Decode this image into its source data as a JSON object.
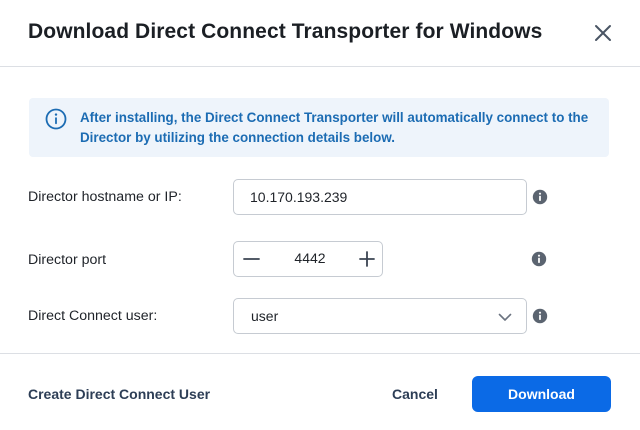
{
  "dialog": {
    "title": "Download Direct Connect Transporter for Windows",
    "close_icon": "close-icon"
  },
  "banner": {
    "icon": "info-icon",
    "text": "After installing, the Direct Connect Transporter will automatically connect to the Director by utilizing the connection details below."
  },
  "form": {
    "hostname": {
      "label": "Director hostname or IP:",
      "value": "10.170.193.239",
      "help_icon": "info-filled-icon"
    },
    "port": {
      "label": "Director port",
      "value": "4442",
      "decrement_icon": "minus-icon",
      "increment_icon": "plus-icon",
      "help_icon": "info-filled-icon"
    },
    "user": {
      "label": "Direct Connect user:",
      "selected": "user",
      "dropdown_icon": "chevron-down-icon",
      "help_icon": "info-filled-icon"
    }
  },
  "footer": {
    "create_link": "Create Direct Connect User",
    "cancel_label": "Cancel",
    "download_label": "Download"
  },
  "colors": {
    "accent": "#0b6ae6",
    "banner_bg": "#eef4fb",
    "banner_text": "#1c6cb3",
    "secondary_text": "#2d3e56",
    "border": "#c6cbd2"
  }
}
